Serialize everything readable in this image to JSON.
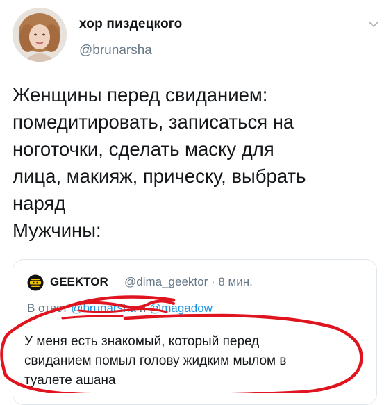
{
  "tweet": {
    "author_name": "хор пиздецкого",
    "author_handle": "@brunarsha",
    "menu_icon": "chevron-down-icon",
    "avatar_icon": "avatar-photo",
    "text_lines": [
      "Женщины перед свиданием:",
      "помедитировать, записаться на",
      "ноготочки, сделать маску для",
      "лица, макияж, прическу, выбрать",
      "наряд",
      "Мужчины:"
    ]
  },
  "quote": {
    "logo_icon": "geektor-logo-icon",
    "author_name": "GEEKTOR",
    "meta": "@dima_geektor · 8 мин.",
    "reply_prefix": "В ответ",
    "reply_mention_1": "@brunarsha",
    "reply_and": "и",
    "reply_mention_2": "@magadow",
    "text_lines": [
      "У меня есть знакомый, который перед",
      "свиданием помыл голову жидким мылом в",
      "туалете ашана"
    ]
  },
  "colors": {
    "text_primary": "#14171a",
    "text_secondary": "#657786",
    "link": "#1b95e0",
    "border": "#e1e8ed",
    "annotation_red": "#e0141e"
  }
}
